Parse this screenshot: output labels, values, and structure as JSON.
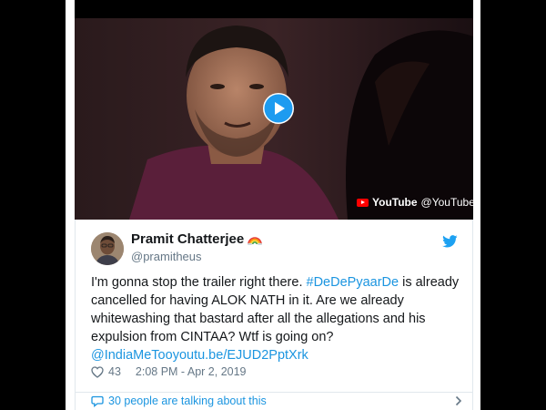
{
  "video": {
    "play_label": "Play",
    "source_name": "YouTube",
    "source_handle": "@YouTube"
  },
  "tweet": {
    "display_name": "Pramit Chatterjee",
    "emoji": "🌈",
    "handle": "@pramitheus",
    "text": {
      "part1": "I'm gonna stop the trailer right there. ",
      "hashtag": "#DeDePyaarDe",
      "part2": " is already cancelled for having ALOK NATH in it. Are we already whitewashing that bastard after all the allegations and his expulsion from CINTAA? Wtf is going on? ",
      "mention": "@IndiaMeToo",
      "link": "youtu.be/EJUD2PptXrk"
    },
    "like_count": "43",
    "timestamp": "2:08 PM - Apr 2, 2019"
  },
  "conversation": {
    "label": "30 people are talking about this"
  },
  "colors": {
    "link_blue": "#1b95e0",
    "text_primary": "#14171a",
    "text_secondary": "#657786",
    "youtube_red": "#ff0000"
  },
  "icons": [
    "info-icon",
    "play-icon",
    "youtube-icon",
    "twitter-bird-icon",
    "rainbow-icon",
    "heart-icon",
    "speech-bubble-icon",
    "chevron-right-icon"
  ]
}
